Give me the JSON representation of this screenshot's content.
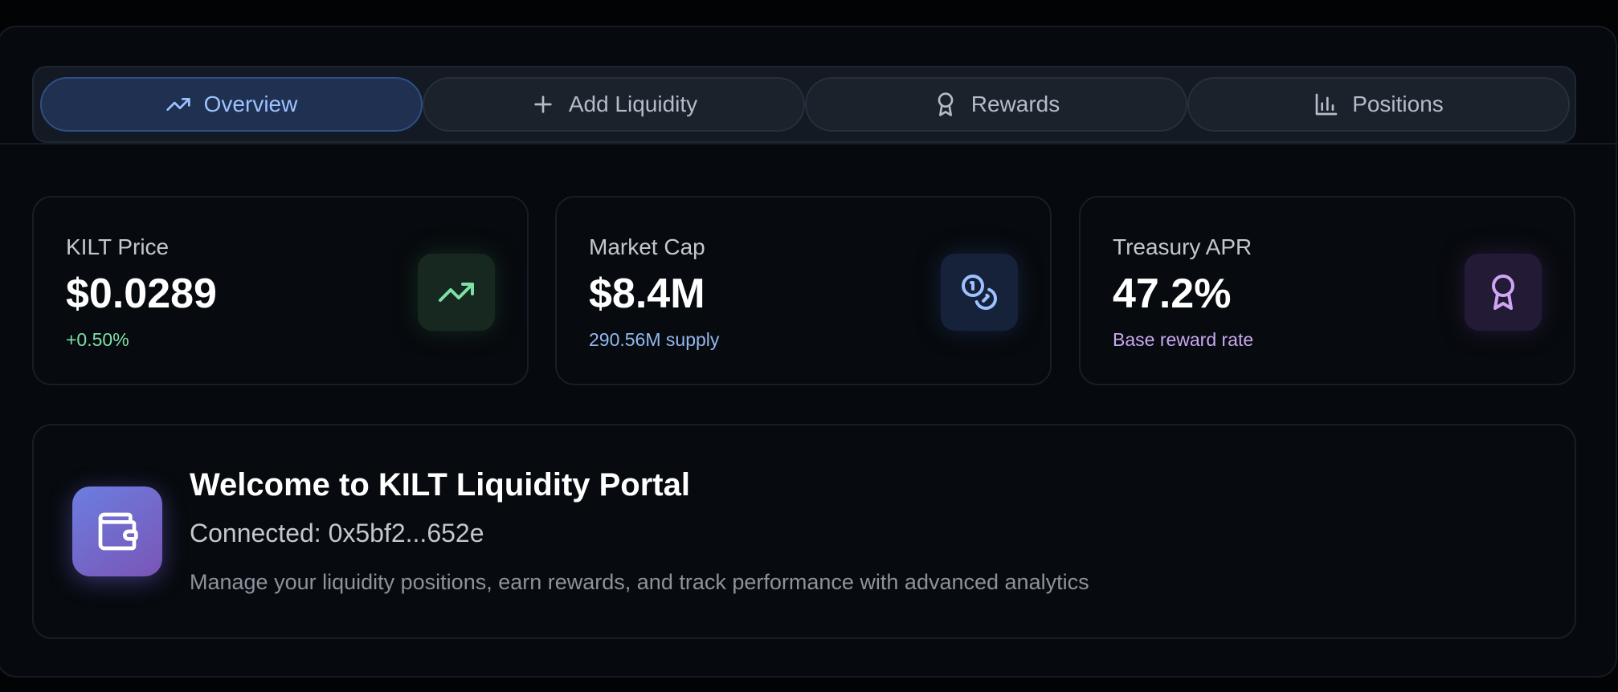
{
  "tabs": [
    {
      "label": "Overview",
      "icon": "trending-up-icon",
      "active": true
    },
    {
      "label": "Add Liquidity",
      "icon": "plus-icon",
      "active": false
    },
    {
      "label": "Rewards",
      "icon": "award-icon",
      "active": false
    },
    {
      "label": "Positions",
      "icon": "bar-chart-icon",
      "active": false
    }
  ],
  "stats": [
    {
      "label": "KILT Price",
      "value": "$0.0289",
      "sub": "+0.50%",
      "sub_color": "#7ee0a6",
      "icon": "trending-up-icon",
      "icon_color": "#7ee0a6",
      "icon_bg": "#16281f"
    },
    {
      "label": "Market Cap",
      "value": "$8.4M",
      "sub": "290.56M supply",
      "sub_color": "#93b8ef",
      "icon": "coins-icon",
      "icon_color": "#9dc2ff",
      "icon_bg": "#16223a"
    },
    {
      "label": "Treasury APR",
      "value": "47.2%",
      "sub": "Base reward rate",
      "sub_color": "#c8a8f0",
      "icon": "award-icon",
      "icon_color": "#cfa6f5",
      "icon_bg": "#231a35"
    }
  ],
  "welcome": {
    "title": "Welcome to KILT Liquidity Portal",
    "connected": "Connected: 0x5bf2...652e",
    "description": "Manage your liquidity positions, earn rewards, and track performance with advanced analytics",
    "icon": "wallet-icon"
  }
}
